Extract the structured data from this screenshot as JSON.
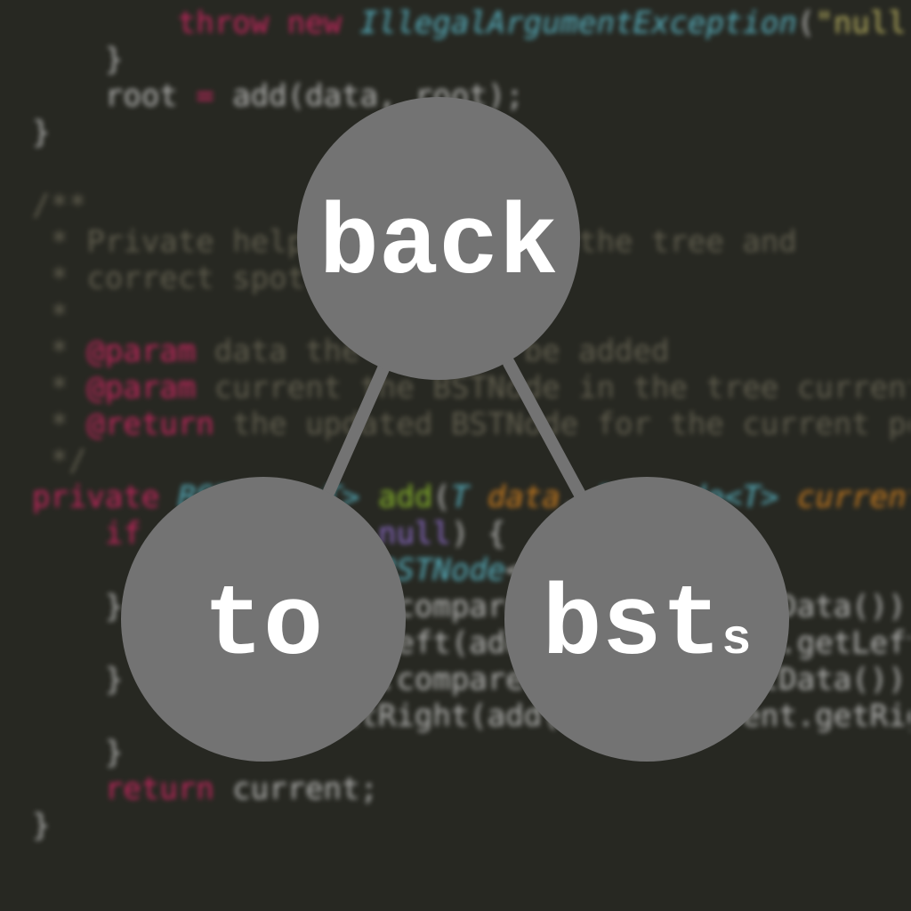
{
  "code_lines": [
    [
      {
        "t": "        ",
        "c": "plain"
      },
      {
        "t": "throw",
        "c": "kw"
      },
      {
        "t": " ",
        "c": "plain"
      },
      {
        "t": "new",
        "c": "kw"
      },
      {
        "t": " ",
        "c": "plain"
      },
      {
        "t": "IllegalArgumentException",
        "c": "type"
      },
      {
        "t": "(",
        "c": "plain"
      },
      {
        "t": "\"null",
        "c": "str"
      }
    ],
    [
      {
        "t": "    }",
        "c": "plain"
      }
    ],
    [
      {
        "t": "    root ",
        "c": "plain"
      },
      {
        "t": "=",
        "c": "kw"
      },
      {
        "t": " add(data, root);",
        "c": "plain"
      }
    ],
    [
      {
        "t": "}",
        "c": "plain"
      }
    ],
    [
      {
        "t": "",
        "c": "plain"
      }
    ],
    [
      {
        "t": "/**",
        "c": "cm"
      }
    ],
    [
      {
        "t": " * Private helper to traverse the tree and",
        "c": "cm"
      }
    ],
    [
      {
        "t": " * correct spot",
        "c": "cm"
      }
    ],
    [
      {
        "t": " *",
        "c": "cm"
      }
    ],
    [
      {
        "t": " * ",
        "c": "cm"
      },
      {
        "t": "@param",
        "c": "kw"
      },
      {
        "t": " data the data to be added",
        "c": "cm"
      }
    ],
    [
      {
        "t": " * ",
        "c": "cm"
      },
      {
        "t": "@param",
        "c": "kw"
      },
      {
        "t": " current the BSTNode in the tree current",
        "c": "cm"
      }
    ],
    [
      {
        "t": " * ",
        "c": "cm"
      },
      {
        "t": "@return",
        "c": "kw"
      },
      {
        "t": " the updated BSTNode for the current po",
        "c": "cm"
      }
    ],
    [
      {
        "t": " */",
        "c": "cm"
      }
    ],
    [
      {
        "t": "private",
        "c": "kw"
      },
      {
        "t": " ",
        "c": "plain"
      },
      {
        "t": "BSTNode<T>",
        "c": "type"
      },
      {
        "t": " ",
        "c": "plain"
      },
      {
        "t": "add",
        "c": "fn"
      },
      {
        "t": "(",
        "c": "plain"
      },
      {
        "t": "T",
        "c": "type"
      },
      {
        "t": " ",
        "c": "plain"
      },
      {
        "t": "data",
        "c": "param"
      },
      {
        "t": ", ",
        "c": "plain"
      },
      {
        "t": "BSTNode<T>",
        "c": "type"
      },
      {
        "t": " ",
        "c": "plain"
      },
      {
        "t": "current",
        "c": "param"
      }
    ],
    [
      {
        "t": "    ",
        "c": "plain"
      },
      {
        "t": "if",
        "c": "kw"
      },
      {
        "t": " (current ",
        "c": "plain"
      },
      {
        "t": "==",
        "c": "kw"
      },
      {
        "t": " ",
        "c": "plain"
      },
      {
        "t": "null",
        "c": "const"
      },
      {
        "t": ") {",
        "c": "plain"
      }
    ],
    [
      {
        "t": "        ",
        "c": "plain"
      },
      {
        "t": "return",
        "c": "kw"
      },
      {
        "t": " ",
        "c": "plain"
      },
      {
        "t": "new",
        "c": "kw"
      },
      {
        "t": " ",
        "c": "plain"
      },
      {
        "t": "BSTNode",
        "c": "type"
      },
      {
        "t": "<>(data);",
        "c": "plain"
      }
    ],
    [
      {
        "t": "    } ",
        "c": "plain"
      },
      {
        "t": "else if",
        "c": "kw"
      },
      {
        "t": " (data.compareTo(current.getData())",
        "c": "plain"
      }
    ],
    [
      {
        "t": "        current.setLeft(add(data, current.getLeft",
        "c": "plain"
      }
    ],
    [
      {
        "t": "    } ",
        "c": "plain"
      },
      {
        "t": "else if",
        "c": "kw"
      },
      {
        "t": " (data.compareTo(current.getData())",
        "c": "plain"
      }
    ],
    [
      {
        "t": "        current.setRight(add(data, current.getRig",
        "c": "plain"
      }
    ],
    [
      {
        "t": "    }",
        "c": "plain"
      }
    ],
    [
      {
        "t": "    ",
        "c": "plain"
      },
      {
        "t": "return",
        "c": "kw"
      },
      {
        "t": " current;",
        "c": "plain"
      }
    ],
    [
      {
        "t": "}",
        "c": "plain"
      }
    ]
  ],
  "tree": {
    "root": {
      "word": "back",
      "sub": ""
    },
    "left": {
      "word": "to",
      "sub": ""
    },
    "right": {
      "word": "bst",
      "sub": "s"
    }
  },
  "colors": {
    "background": "#272822",
    "node_fill": "#737373",
    "node_text": "#ffffff"
  }
}
